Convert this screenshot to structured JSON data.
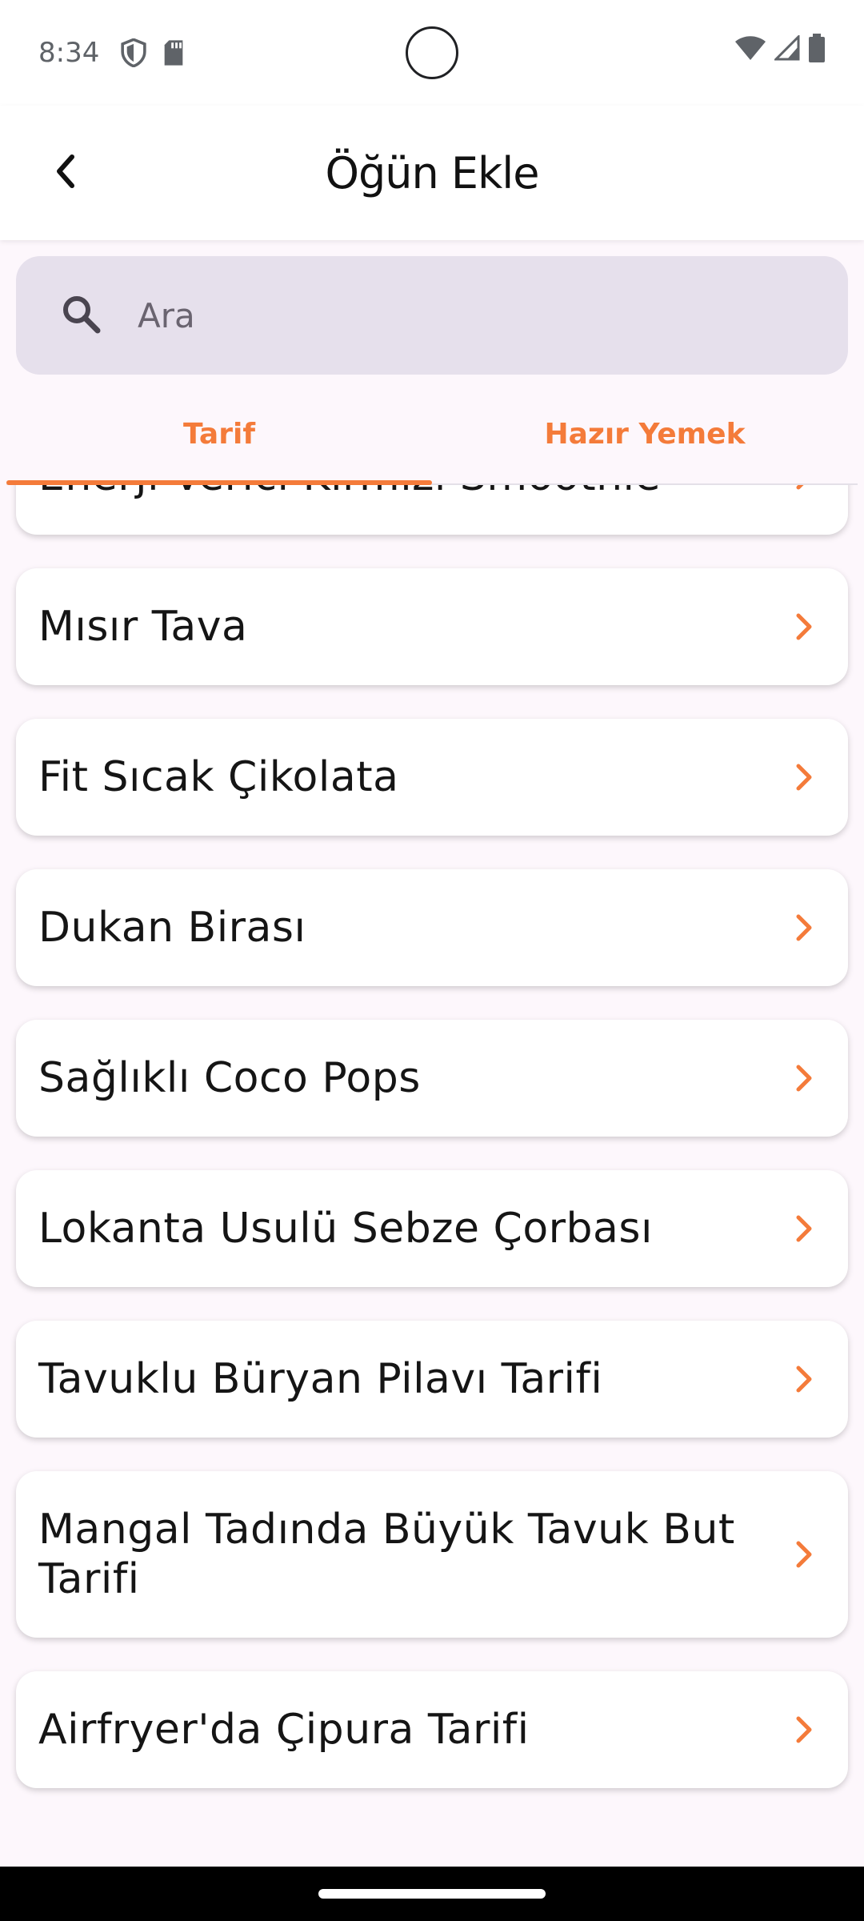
{
  "status_bar": {
    "time": "8:34",
    "icons": [
      "shield-icon",
      "sd-card-icon",
      "wifi-icon",
      "signal-icon",
      "battery-icon"
    ]
  },
  "app_bar": {
    "title": "Öğün Ekle",
    "back_icon": "chevron-left-icon"
  },
  "search": {
    "placeholder": "Ara",
    "icon": "search-icon"
  },
  "tabs": [
    {
      "label": "Tarif",
      "active": true
    },
    {
      "label": "Hazır Yemek",
      "active": false
    }
  ],
  "accent_color": "#f47b3a",
  "items": [
    {
      "label": "Enerji Verici Kırmızı Smoothie"
    },
    {
      "label": "Mısır Tava"
    },
    {
      "label": "Fit Sıcak Çikolata"
    },
    {
      "label": "Dukan Birası"
    },
    {
      "label": "Sağlıklı Coco Pops"
    },
    {
      "label": "Lokanta Usulü Sebze Çorbası"
    },
    {
      "label": "Tavuklu Büryan Pilavı Tarifi"
    },
    {
      "label": "Mangal Tadında Büyük Tavuk But Tarifi"
    },
    {
      "label": "Airfryer'da Çipura Tarifi"
    }
  ]
}
